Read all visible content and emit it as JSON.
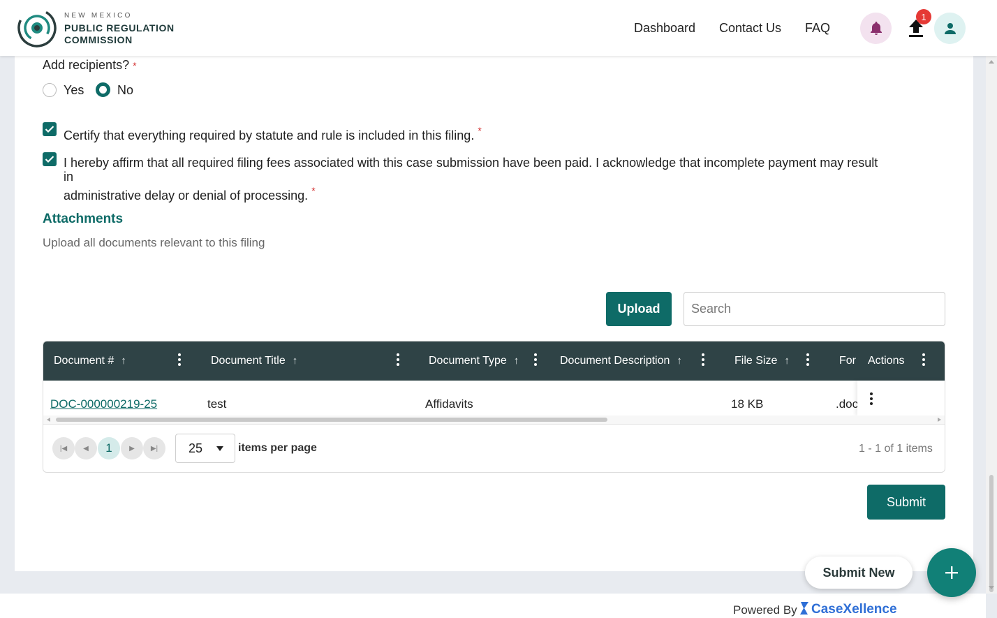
{
  "header": {
    "logo_line1": "NEW MEXICO",
    "logo_line2": "PUBLIC REGULATION",
    "logo_line3": "COMMISSION",
    "nav": [
      "Dashboard",
      "Contact Us",
      "FAQ"
    ],
    "upload_badge": "1",
    "icons": [
      "bell-icon",
      "upload-icon",
      "user-icon"
    ]
  },
  "form": {
    "recipients_question": "Add recipients?",
    "required_mark": "*",
    "radio_yes": "Yes",
    "radio_no": "No",
    "selected": "No",
    "certify_text": "Certify that everything required by statute and rule is included in this filing.",
    "affirm_line1": "I hereby affirm that all required filing fees associated with this case submission have been paid. I acknowledge that incomplete payment may result in",
    "affirm_line2": "administrative delay or denial of processing."
  },
  "attachments": {
    "title": "Attachments",
    "subtitle": "Upload all documents relevant to this filing",
    "upload_label": "Upload",
    "search_placeholder": "Search",
    "columns": [
      "Document #",
      "Document Title",
      "Document Type",
      "Document Description",
      "File Size",
      "For",
      "Actions"
    ],
    "rows": [
      {
        "doc_number": "DOC-000000219-25",
        "title": "test",
        "type": "Affidavits",
        "description": "",
        "size": "18 KB",
        "format": ".doc"
      }
    ],
    "pager": {
      "current_page": "1",
      "page_size": "25",
      "items_per_page_label": "items per page",
      "summary": "1 - 1 of 1 items"
    }
  },
  "actions": {
    "submit_label": "Submit",
    "submit_new_label": "Submit New"
  },
  "footer": {
    "powered_by": "Powered By",
    "brand": "CaseXellence"
  },
  "colors": {
    "primary": "#0e6b67",
    "grid_header": "#2f4346",
    "badge": "#e53935",
    "brand_blue": "#2f6fd6"
  }
}
